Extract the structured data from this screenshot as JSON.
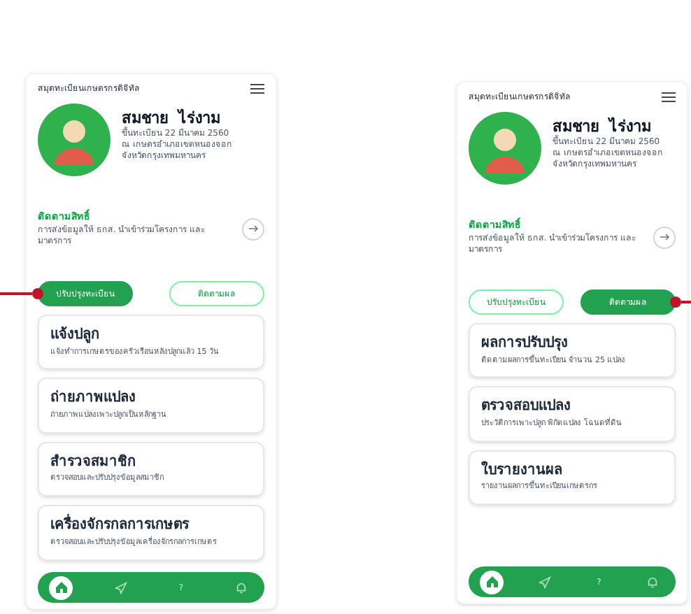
{
  "screens": [
    {
      "header": "สมุดทะเบียนเกษตรกรดิจิทัล",
      "profile": {
        "name": "สมชาย  ไร่งาม",
        "lines": [
          "ขึ้นทะเบียน 22 มีนาคม 2560",
          "ณ เกษตรอำเภอเขตหนองจอก",
          "จังหวัดกรุงเทพมหานคร"
        ]
      },
      "rights": {
        "title": "ติดตามสิทธิ์",
        "text": "การส่งข้อมูลให้ ธกส. นำเข้าร่วมโครงการ และมาตรการ"
      },
      "tabs": [
        {
          "label": "ปรับปรุงทะเบียน",
          "selected": true
        },
        {
          "label": "ติดตามผล",
          "selected": false
        }
      ],
      "cards": [
        {
          "title": "แจ้งปลูก",
          "text": "แจ้งทำการเกษตรของครัวเรือนหลังปลูกแล้ว 15 วัน"
        },
        {
          "title": "ถ่ายภาพแปลง",
          "text": "ถ่ายภาพแปลงเพาะปลูกเป็นหลักฐาน"
        },
        {
          "title": "สำรวจสมาชิก",
          "text": "ตรวจสอบและปรับปรุงข้อมูลสมาชิก"
        },
        {
          "title": "เครื่องจักรกลการเกษตร",
          "text": "ตรวจสอบและปรับปรุงข้อมูลเครื่องจักรกลการเกษตร"
        }
      ],
      "nav": [
        {
          "kind": "home",
          "selected": true
        },
        {
          "kind": "send",
          "selected": false
        },
        {
          "kind": "help",
          "label": "?",
          "selected": false
        },
        {
          "kind": "bell",
          "selected": false
        }
      ]
    },
    {
      "header": "สมุดทะเบียนเกษตรกรดิจิทัล",
      "profile": {
        "name": "สมชาย  ไร่งาม",
        "lines": [
          "ขึ้นทะเบียน 22 มีนาคม 2560",
          "ณ เกษตรอำเภอเขตหนองจอก",
          "จังหวัดกรุงเทพมหานคร"
        ]
      },
      "rights": {
        "title": "ติดตามสิทธิ์",
        "text": "การส่งข้อมูลให้ ธกส. นำเข้าร่วมโครงการ และมาตรการ"
      },
      "tabs": [
        {
          "label": "ปรับปรุงทะเบียน",
          "selected": false
        },
        {
          "label": "ติดตามผล",
          "selected": true
        }
      ],
      "cards": [
        {
          "title": "ผลการปรับปรุง",
          "text": "ติดตามผลการขึ้นทะเบียน จำนวน 25 แปลง"
        },
        {
          "title": "ตรวจสอบแปลง",
          "text": "ประวัติการเพาะปลูก พิกัดแปลง โฉนดที่ดิน"
        },
        {
          "title": "ใบรายงานผล",
          "text": "รายงานผลการขึ้นทะเบียนเกษตรกร"
        }
      ],
      "nav": [
        {
          "kind": "home",
          "selected": true
        },
        {
          "kind": "send",
          "selected": false
        },
        {
          "kind": "help",
          "label": "?",
          "selected": false
        },
        {
          "kind": "bell",
          "selected": false
        }
      ]
    }
  ]
}
